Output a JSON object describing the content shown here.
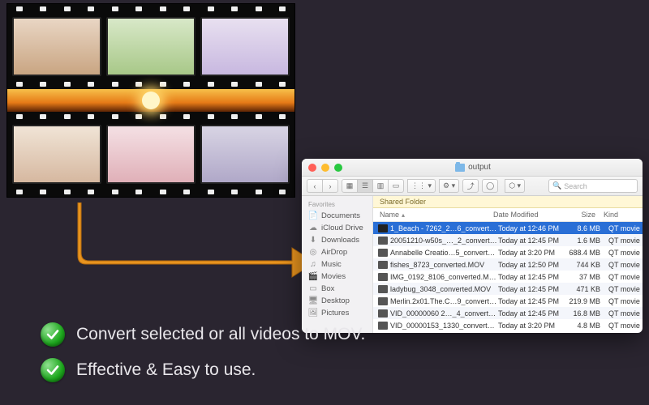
{
  "finder": {
    "title": "output",
    "search_placeholder": "Search",
    "sidebar": {
      "header": "Favorites",
      "items": [
        {
          "label": "Documents",
          "icon": "doc-icon"
        },
        {
          "label": "iCloud Drive",
          "icon": "cloud-icon"
        },
        {
          "label": "Downloads",
          "icon": "download-icon"
        },
        {
          "label": "AirDrop",
          "icon": "airdrop-icon"
        },
        {
          "label": "Music",
          "icon": "music-icon"
        },
        {
          "label": "Movies",
          "icon": "movie-icon"
        },
        {
          "label": "Box",
          "icon": "box-icon"
        },
        {
          "label": "Desktop",
          "icon": "desktop-icon"
        },
        {
          "label": "Pictures",
          "icon": "pictures-icon"
        }
      ]
    },
    "shared_label": "Shared Folder",
    "columns": {
      "name": "Name",
      "date": "Date Modified",
      "size": "Size",
      "kind": "Kind"
    },
    "rows": [
      {
        "name": "1_Beach - 7262_2…6_converted.MOV",
        "date": "Today at 12:46 PM",
        "size": "8.6 MB",
        "kind": "QT movie",
        "selected": true
      },
      {
        "name": "20051210-w50s_…_2_converted.MOV",
        "date": "Today at 12:45 PM",
        "size": "1.6 MB",
        "kind": "QT movie"
      },
      {
        "name": "Annabelle Creatio…5_converted.MOV",
        "date": "Today at 3:20 PM",
        "size": "688.4 MB",
        "kind": "QT movie"
      },
      {
        "name": "fishes_8723_converted.MOV",
        "date": "Today at 12:50 PM",
        "size": "744 KB",
        "kind": "QT movie"
      },
      {
        "name": "IMG_0192_8106_converted.MOV",
        "date": "Today at 12:45 PM",
        "size": "37 MB",
        "kind": "QT movie"
      },
      {
        "name": "ladybug_3048_converted.MOV",
        "date": "Today at 12:45 PM",
        "size": "471 KB",
        "kind": "QT movie"
      },
      {
        "name": "Merlin.2x01.The.C…9_converted.MOV",
        "date": "Today at 12:45 PM",
        "size": "219.9 MB",
        "kind": "QT movie"
      },
      {
        "name": "VID_00000060 2…_4_converted.MOV",
        "date": "Today at 12:45 PM",
        "size": "16.8 MB",
        "kind": "QT movie"
      },
      {
        "name": "VID_00000153_1330_converted.MOV",
        "date": "Today at 3:20 PM",
        "size": "4.8 MB",
        "kind": "QT movie"
      }
    ]
  },
  "bullets": [
    "Convert selected or all videos to MOV.",
    "Effective & Easy to use."
  ]
}
